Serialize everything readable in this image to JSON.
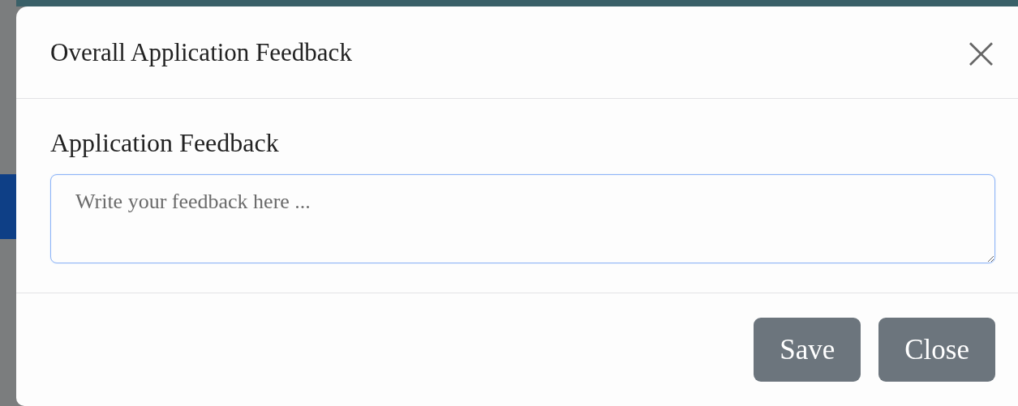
{
  "modal": {
    "title": "Overall Application Feedback",
    "close_icon": "×"
  },
  "field": {
    "label": "Application Feedback",
    "placeholder": "Write your feedback here ...",
    "focused": true
  },
  "buttons": [
    {
      "label": "Save"
    },
    {
      "label": "Close"
    }
  ]
}
